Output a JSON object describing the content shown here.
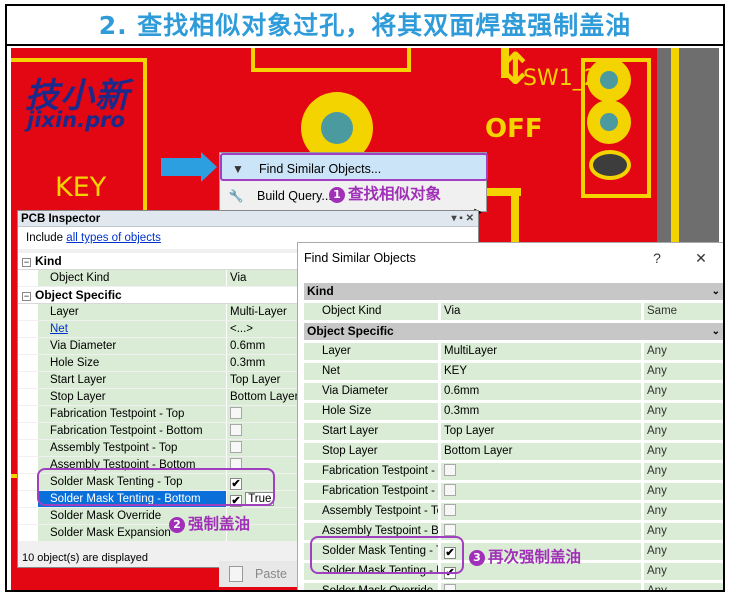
{
  "title": "2. 查找相似对象过孔，将其双面焊盘强制盖油",
  "colors": {
    "board": "#e30613",
    "gold": "#f4d400",
    "accent": "#a030b8",
    "title": "#2f9bd9"
  },
  "pcb": {
    "logo_zh": "技小新",
    "logo_en": "jixin.pro",
    "key_label": "KEY",
    "sw_label": "SW1_2",
    "off_label": "OFF"
  },
  "context_menu": {
    "items": [
      {
        "label": "Find Similar Objects...",
        "icon": "funnel-icon"
      },
      {
        "label": "Build Query...",
        "icon": "wrench-icon"
      }
    ]
  },
  "steps": {
    "step1": {
      "num": "1",
      "text": "查找相似对象"
    },
    "step2": {
      "num": "2",
      "text": "强制盖油"
    },
    "step3": {
      "num": "3",
      "text": "再次强制盖油"
    }
  },
  "inspector": {
    "title": "PCB Inspector",
    "include_prefix": "Include",
    "include_link": "all types of objects",
    "sections": [
      {
        "name": "Kind",
        "rows": [
          {
            "name": "Object Kind",
            "value": "Via"
          }
        ]
      },
      {
        "name": "Object Specific",
        "rows": [
          {
            "name": "Layer",
            "value": "Multi-Layer"
          },
          {
            "name": "Net",
            "value": "<...>",
            "link": true
          },
          {
            "name": "Via Diameter",
            "value": "0.6mm"
          },
          {
            "name": "Hole Size",
            "value": "0.3mm"
          },
          {
            "name": "Start Layer",
            "value": "Top Layer"
          },
          {
            "name": "Stop Layer",
            "value": "Bottom Layer"
          },
          {
            "name": "Fabrication Testpoint - Top",
            "check": false
          },
          {
            "name": "Fabrication Testpoint - Bottom",
            "check": false
          },
          {
            "name": "Assembly Testpoint - Top",
            "check": false
          },
          {
            "name": "Assembly Testpoint - Bottom",
            "check": false
          },
          {
            "name": "Solder Mask Tenting - Top",
            "check": true
          },
          {
            "name": "Solder Mask Tenting - Bottom",
            "check": true,
            "value": "True",
            "selected": true
          },
          {
            "name": "Solder Mask Override",
            "value": ""
          },
          {
            "name": "Solder Mask Expansion",
            "value": ""
          }
        ]
      }
    ],
    "status": "10 object(s) are displayed"
  },
  "paste_label": "Paste",
  "find_similar": {
    "title": "Find Similar Objects",
    "help": "?",
    "close": "✕",
    "sections": [
      {
        "name": "Kind",
        "rows": [
          {
            "name": "Object Kind",
            "value": "Via",
            "match": "Same"
          }
        ]
      },
      {
        "name": "Object Specific",
        "rows": [
          {
            "name": "Layer",
            "value": "MultiLayer",
            "match": "Any"
          },
          {
            "name": "Net",
            "value": "KEY",
            "match": "Any"
          },
          {
            "name": "Via Diameter",
            "value": "0.6mm",
            "match": "Any"
          },
          {
            "name": "Hole Size",
            "value": "0.3mm",
            "match": "Any"
          },
          {
            "name": "Start Layer",
            "value": "Top Layer",
            "match": "Any"
          },
          {
            "name": "Stop Layer",
            "value": "Bottom Layer",
            "match": "Any"
          },
          {
            "name": "Fabrication Testpoint - T",
            "check": false,
            "match": "Any"
          },
          {
            "name": "Fabrication Testpoint - B",
            "check": false,
            "match": "Any"
          },
          {
            "name": "Assembly Testpoint - Top",
            "check": false,
            "match": "Any"
          },
          {
            "name": "Assembly Testpoint - Bot",
            "check": false,
            "match": "Any"
          },
          {
            "name": "Solder Mask Tenting - T",
            "check": true,
            "match": "Any"
          },
          {
            "name": "Solder Mask Tenting - B",
            "check": true,
            "match": "Any"
          },
          {
            "name": "Solder Mask Override",
            "check": false,
            "match": "Any"
          }
        ]
      }
    ]
  }
}
